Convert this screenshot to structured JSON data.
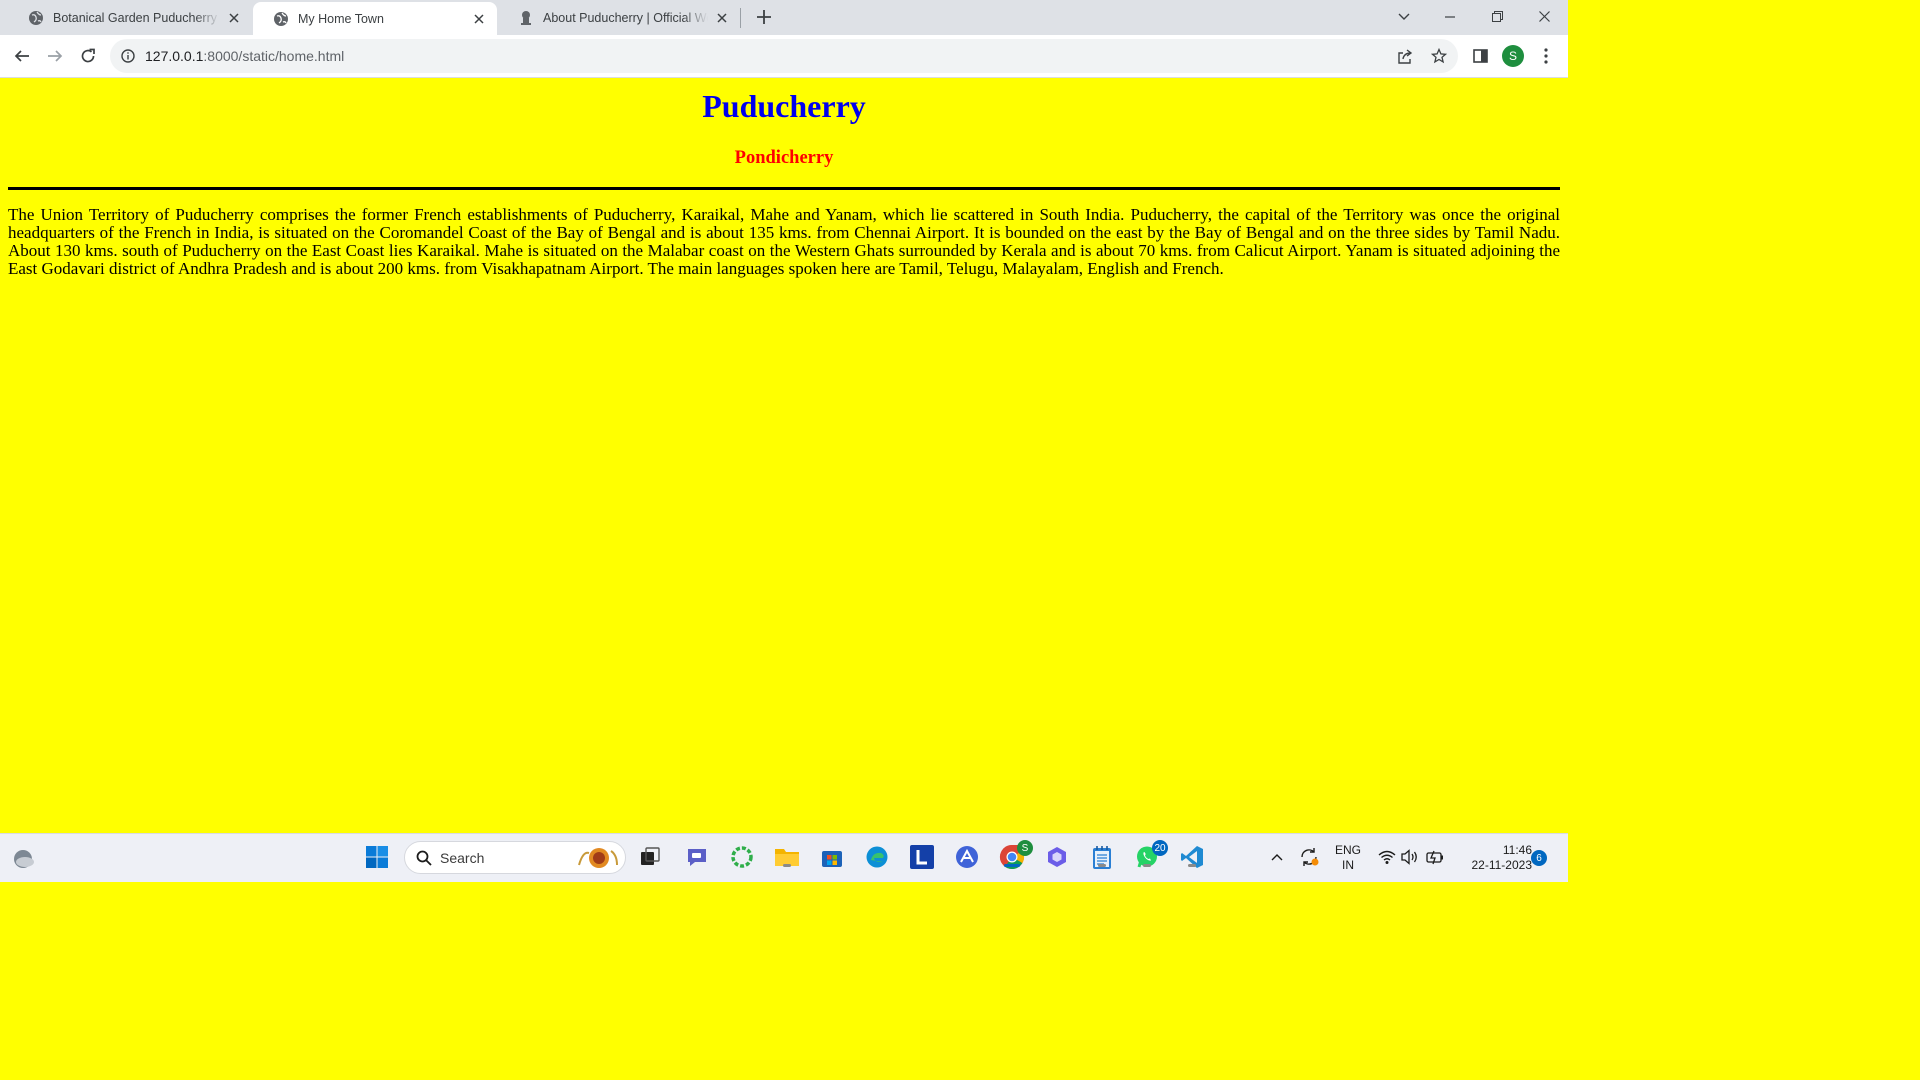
{
  "browser": {
    "tabs": [
      {
        "title": "Botanical Garden Puducherry (En",
        "active": false,
        "icon": "globe-icon"
      },
      {
        "title": "My Home Town",
        "active": true,
        "icon": "globe-icon"
      },
      {
        "title": "About Puducherry | Official Web",
        "active": false,
        "icon": "emblem-icon"
      }
    ],
    "url_host": "127.0.0.1",
    "url_rest": ":8000/static/home.html",
    "profile_initial": "S"
  },
  "page": {
    "title": "Puducherry",
    "subtitle": "Pondicherry",
    "paragraph": "The Union Territory of Puducherry comprises the former French establishments of Puducherry, Karaikal, Mahe and Yanam, which lie scattered in South India. Puducherry, the capital of the Territory was once the original headquarters of the French in India, is situated on the Coromandel Coast of the Bay of Bengal and is about 135 kms. from Chennai Airport. It is bounded on the east by the Bay of Bengal and on the three sides by Tamil Nadu. About 130 kms. south of Puducherry on the East Coast lies Karaikal. Mahe is situated on the Malabar coast on the Western Ghats surrounded by Kerala and is about 70 kms. from Calicut Airport. Yanam is situated adjoining the East Godavari district of Andhra Pradesh and is about 200 kms. from Visakhapatnam Airport. The main languages spoken here are Tamil, Telugu, Malayalam, English and French.",
    "colors": {
      "background": "#ffff00",
      "title": "#0000ee",
      "subtitle": "#ff0000"
    }
  },
  "taskbar": {
    "search_placeholder": "Search",
    "chrome_badge": "S",
    "whatsapp_badge": "20",
    "language_line1": "ENG",
    "language_line2": "IN",
    "time": "11:46",
    "date": "22-11-2023",
    "notification_count": "6"
  }
}
